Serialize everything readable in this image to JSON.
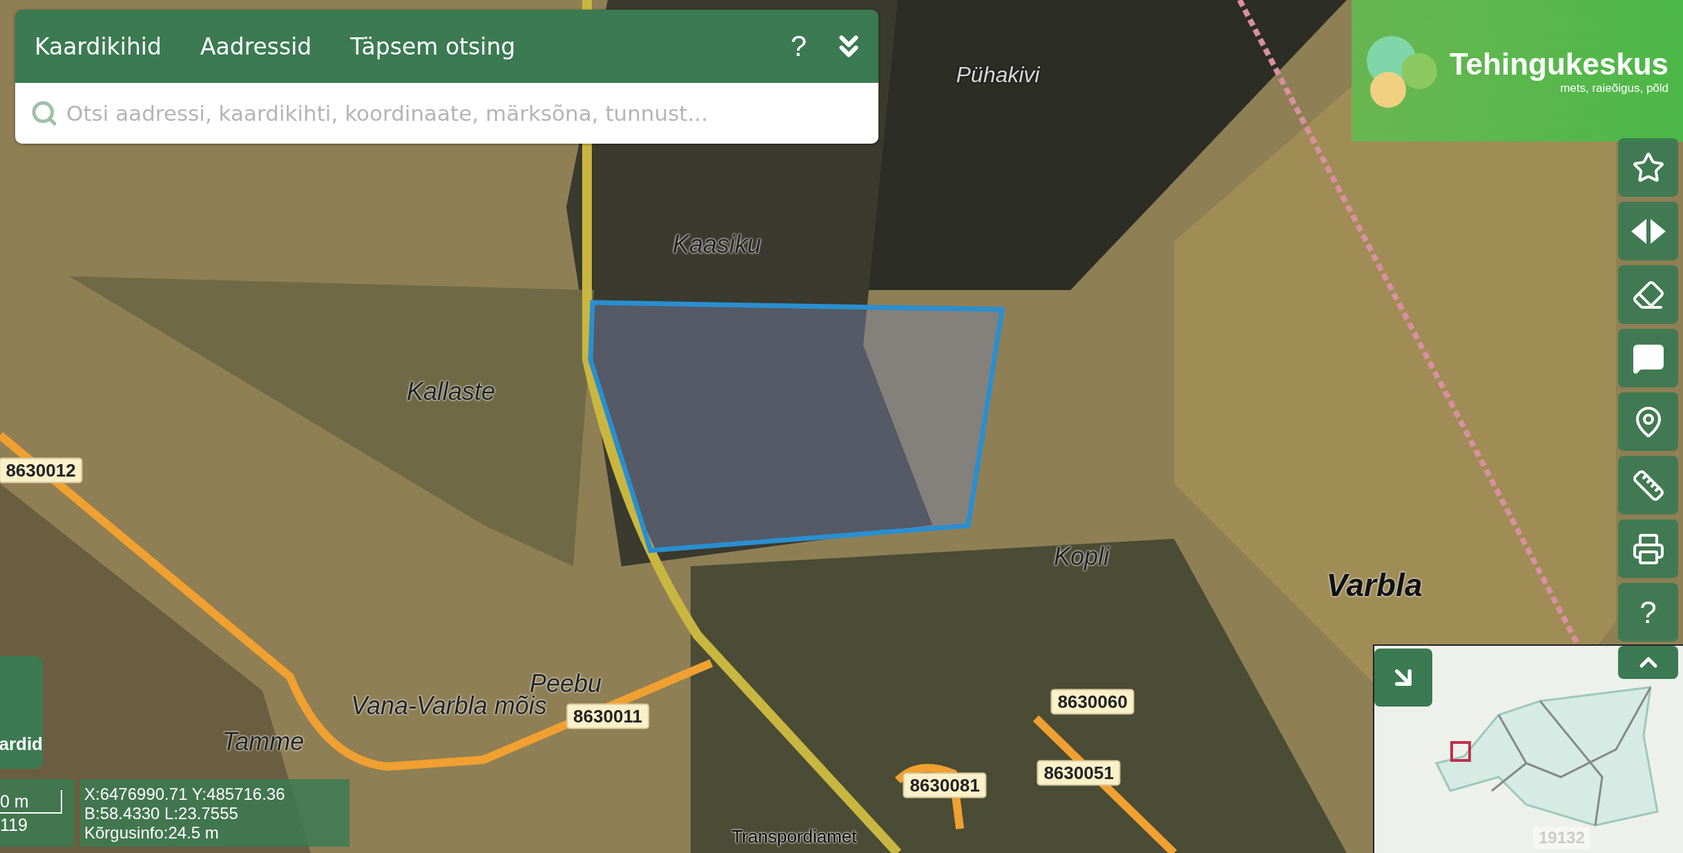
{
  "search_panel": {
    "tabs": [
      {
        "label": "Kaardikihid"
      },
      {
        "label": "Aadressid"
      },
      {
        "label": "Täpsem otsing"
      }
    ],
    "help": "?",
    "placeholder": "Otsi aadressi, kaardikihti, koordinaate, märksõna, tunnust..."
  },
  "logo": {
    "name": "Tehingukeskus",
    "tagline": "mets, raieõigus, põld"
  },
  "toolbar": [
    {
      "kind": "star"
    },
    {
      "kind": "split"
    },
    {
      "kind": "eraser"
    },
    {
      "kind": "feedback"
    },
    {
      "kind": "pin"
    },
    {
      "kind": "ruler"
    },
    {
      "kind": "print"
    },
    {
      "kind": "help",
      "label": "?"
    }
  ],
  "map_labels": [
    {
      "kind": "place_light",
      "text": "Pühakivi"
    },
    {
      "kind": "place",
      "text": "Kaasiku"
    },
    {
      "kind": "place",
      "text": "Kallaste"
    },
    {
      "kind": "place",
      "text": "Kopli"
    },
    {
      "kind": "region",
      "text": "Varbla"
    },
    {
      "kind": "place",
      "text": "Peebu"
    },
    {
      "kind": "place",
      "text": "Vana-Varbla mõis"
    },
    {
      "kind": "place",
      "text": "Tamme"
    },
    {
      "kind": "road",
      "text": "8630012"
    },
    {
      "kind": "road",
      "text": "8630011"
    },
    {
      "kind": "road",
      "text": "8630060"
    },
    {
      "kind": "road",
      "text": "8630081"
    },
    {
      "kind": "road",
      "text": "8630051"
    },
    {
      "kind": "attribution",
      "text": "Transpordiamet"
    }
  ],
  "layers_button": {
    "label": "ardid"
  },
  "scale": {
    "distance": "0 m",
    "ratio": "119"
  },
  "coordinates": [
    "X:6476990.71 Y:485716.36",
    "B:58.4330 L:23.7555",
    "Kõrgusinfo:24.5 m"
  ],
  "minimap": {
    "road_label": "19132"
  }
}
